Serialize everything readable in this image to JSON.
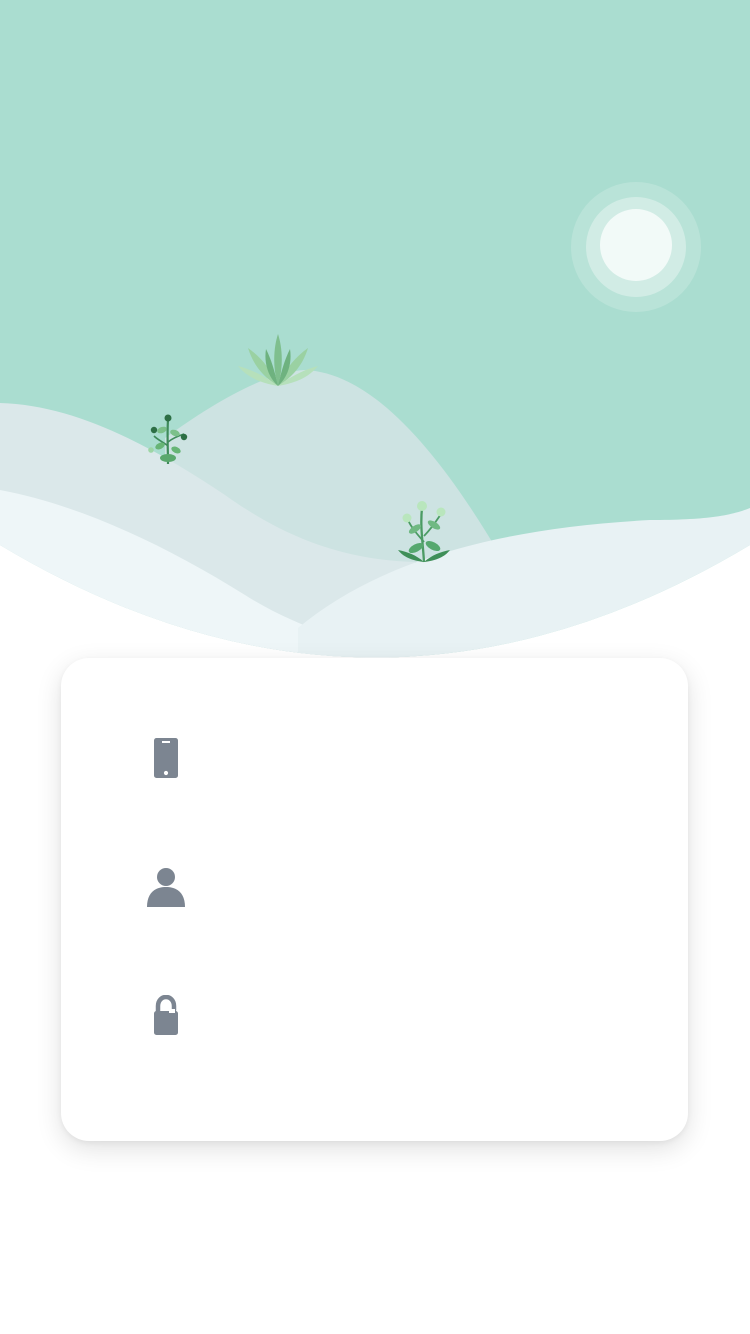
{
  "colors": {
    "sky": "#aaddd0",
    "back_hill": "#cde3e2",
    "left_slope": "#dbe8ea",
    "front_snow": "#eef6f8",
    "right_snow": "#e8f2f4",
    "sun": "#f2faf8",
    "icon_gray": "#7c8591",
    "card_background": "#ffffff"
  },
  "hero": {
    "sun_icon": "sun-icon",
    "plants": [
      "plant-icon",
      "plant-icon",
      "plant-icon"
    ]
  },
  "login_form": {
    "phone": {
      "icon": "phone-icon",
      "value": "",
      "placeholder": ""
    },
    "username": {
      "icon": "user-icon",
      "value": "",
      "placeholder": ""
    },
    "password": {
      "icon": "lock-icon",
      "value": "",
      "placeholder": ""
    }
  }
}
